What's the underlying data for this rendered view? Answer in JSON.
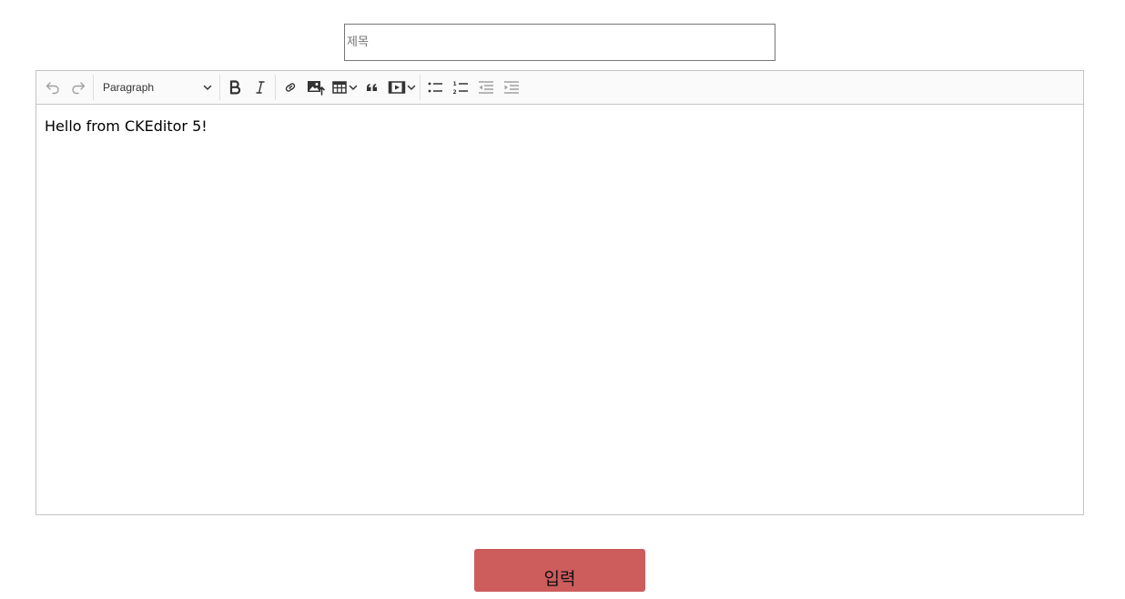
{
  "title_field": {
    "placeholder": "제목",
    "value": ""
  },
  "editor": {
    "toolbar": {
      "undo_icon": "undo-icon",
      "redo_icon": "redo-icon",
      "heading_dropdown_label": "Paragraph",
      "bold_icon": "bold-icon",
      "italic_icon": "italic-icon",
      "link_icon": "link-icon",
      "image_upload_icon": "image-upload-icon",
      "table_icon": "table-icon",
      "blockquote_icon": "blockquote-icon",
      "media_embed_icon": "media-embed-icon",
      "bulleted_list_icon": "bulleted-list-icon",
      "numbered_list_icon": "numbered-list-icon",
      "outdent_icon": "outdent-icon",
      "indent_icon": "indent-icon"
    },
    "content": "Hello from CKEditor 5!"
  },
  "submit_button": {
    "label": "입력",
    "color": "#cd5c5c"
  }
}
